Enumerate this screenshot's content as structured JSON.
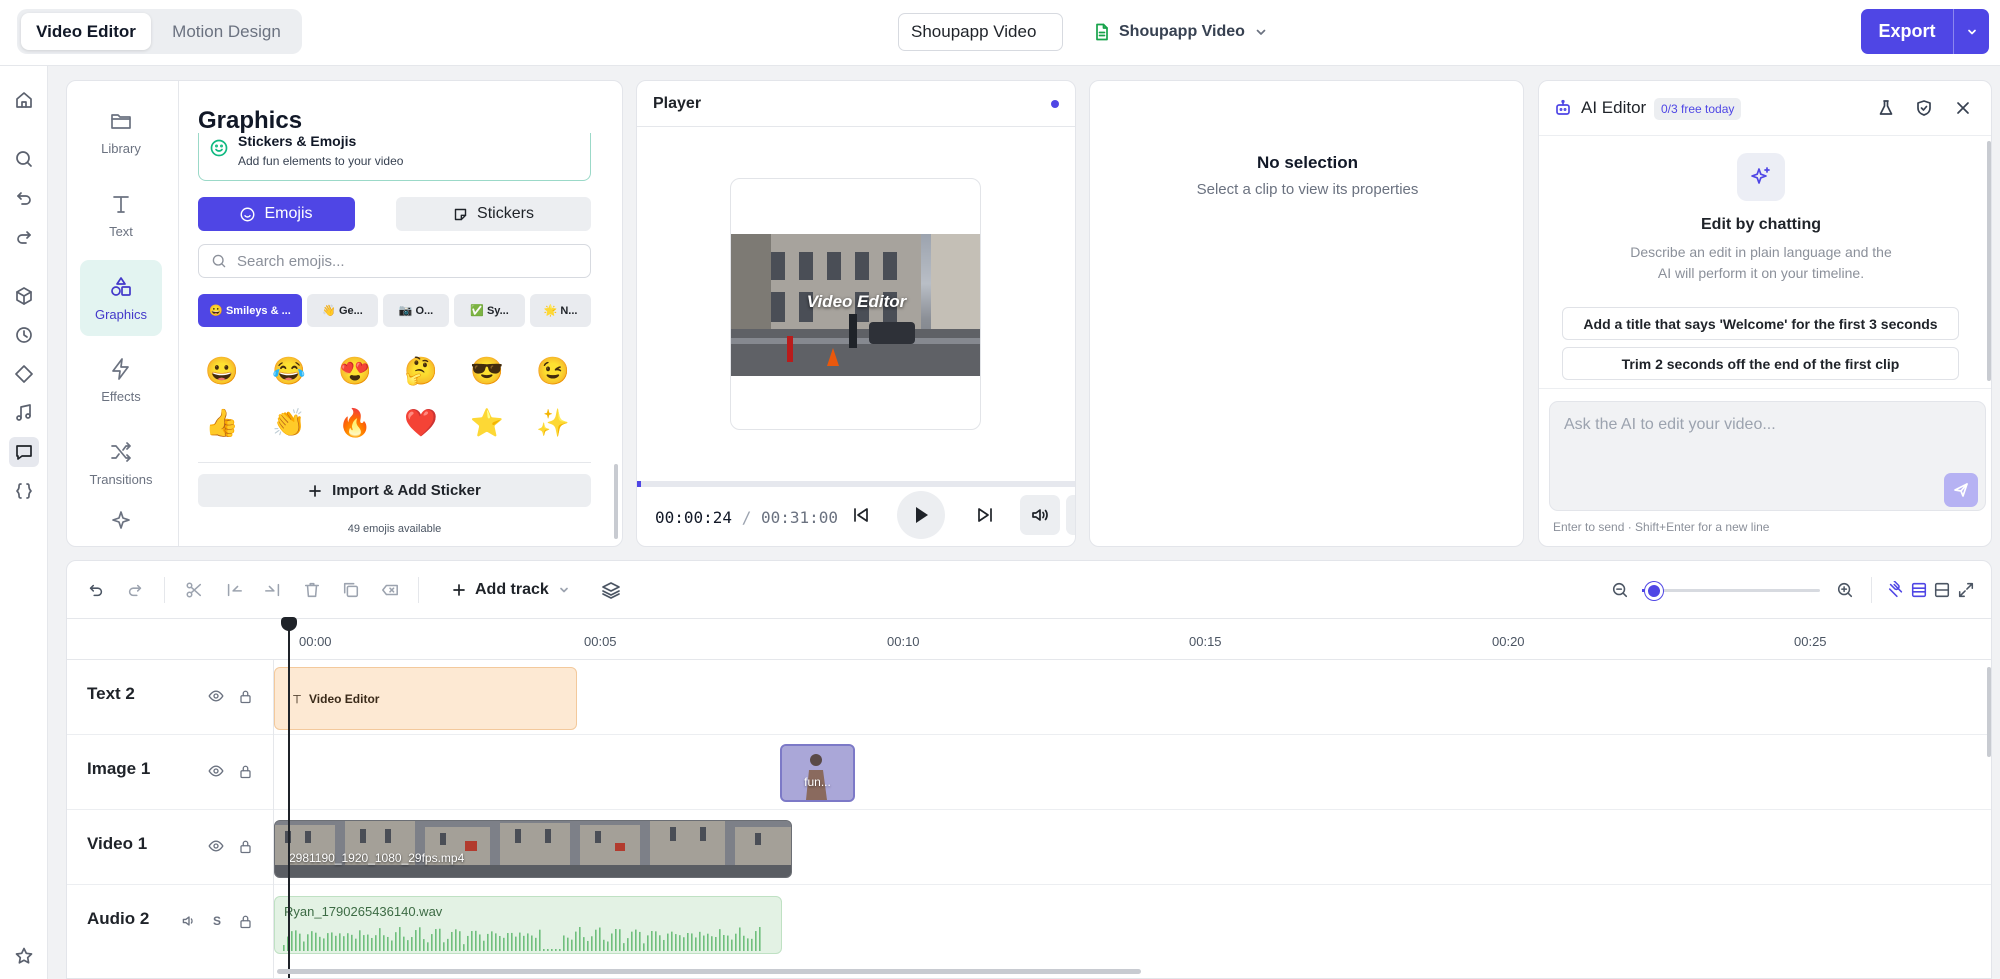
{
  "topbar": {
    "tabs": [
      {
        "label": "Video Editor",
        "active": true
      },
      {
        "label": "Motion Design",
        "active": false
      }
    ],
    "project_name": "Shoupapp Video",
    "doc_name": "Shoupapp Video",
    "export_label": "Export",
    "accent": "#4f46e5"
  },
  "rail": {
    "icons": [
      "home-icon",
      "search-icon",
      "undo-icon",
      "redo-icon",
      "cube-icon",
      "clock-icon",
      "diamond-icon",
      "music-icon",
      "chat-icon",
      "braces-icon",
      "star-icon"
    ],
    "active": "chat-icon"
  },
  "graphics": {
    "side_tabs": [
      {
        "label": "Library",
        "icon": "folder-icon"
      },
      {
        "label": "Text",
        "icon": "text-icon"
      },
      {
        "label": "Graphics",
        "icon": "shapes-icon",
        "active": true
      },
      {
        "label": "Effects",
        "icon": "bolt-icon"
      },
      {
        "label": "Transitions",
        "icon": "shuffle-icon"
      }
    ],
    "title": "Graphics",
    "card_title": "Stickers & Emojis",
    "card_desc": "Add fun elements to your video",
    "toggle_emojis": "Emojis",
    "toggle_stickers": "Stickers",
    "search_placeholder": "Search emojis...",
    "categories": [
      "😀 Smileys & ...",
      "👋 Ge...",
      "📷 O...",
      "✅ Sy...",
      "🌟 N..."
    ],
    "emojis": [
      "😀",
      "😂",
      "😍",
      "🤔",
      "😎",
      "😉",
      "👍",
      "👏",
      "🔥",
      "❤️",
      "⭐",
      "✨"
    ],
    "import_label": "Import & Add Sticker",
    "count_label": "49 emojis available"
  },
  "player": {
    "title": "Player",
    "overlay_text": "Video Editor",
    "current_time": "00:00:24",
    "separator": "/",
    "total_time": "00:31:00",
    "progress": 0.008
  },
  "properties": {
    "title": "No selection",
    "subtitle": "Select a clip to view its properties"
  },
  "ai": {
    "title": "AI Editor",
    "badge": "0/3 free today",
    "heading": "Edit by chatting",
    "desc_line1": "Describe an edit in plain language and the",
    "desc_line2": "AI will perform it on your timeline.",
    "suggestions": [
      "Add a title that says 'Welcome' for the first 3 seconds",
      "Trim 2 seconds off the end of the first clip"
    ],
    "input_placeholder": "Ask the AI to edit your video...",
    "hint": "Enter to send · Shift+Enter for a new line"
  },
  "timeline": {
    "add_track": "Add track",
    "ticks": [
      "00:00",
      "00:05",
      "00:10",
      "00:15",
      "00:20",
      "00:25"
    ],
    "zoom_level": 0.07,
    "tracks": [
      {
        "name": "Text 2",
        "clip": "Video Editor"
      },
      {
        "name": "Image 1",
        "clip": "fun..."
      },
      {
        "name": "Video 1",
        "clip": "2981190_1920_1080_29fps.mp4"
      },
      {
        "name": "Audio 2",
        "clip": "Ryan_1790265436140.wav",
        "solo": "S"
      }
    ],
    "text_clip_color": "#fde9d3",
    "audio_clip_color": "#e3f2e4"
  }
}
